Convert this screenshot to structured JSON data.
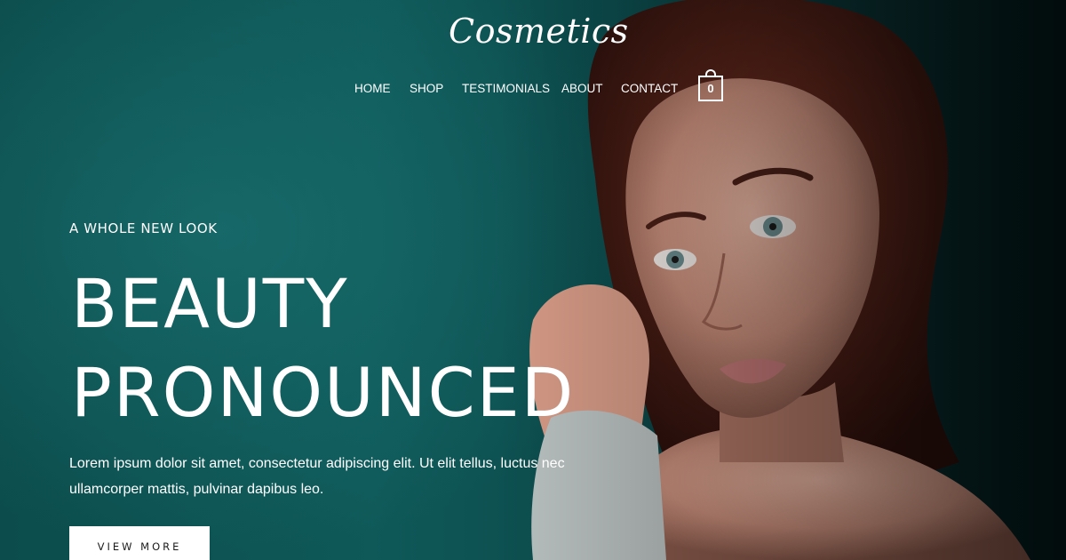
{
  "brand": {
    "logo_text": "Cosmetics"
  },
  "nav": {
    "items": [
      {
        "label": "HOME"
      },
      {
        "label": "SHOP"
      },
      {
        "label": "TESTIMONIALS"
      },
      {
        "label": "ABOUT"
      },
      {
        "label": "CONTACT"
      }
    ],
    "cart": {
      "count": "0",
      "icon": "shopping-bag-icon"
    }
  },
  "hero": {
    "eyebrow": "A WHOLE NEW LOOK",
    "headline_line_1": "BEAUTY",
    "headline_line_2": "PRONOUNCED",
    "body": "Lorem ipsum dolor sit amet, consectetur adipiscing elit. Ut elit tellus, luctus nec ullamcorper mattis, pulvinar dapibus leo.",
    "cta_label": "VIEW MORE"
  },
  "colors": {
    "background_teal": "#0f5959",
    "background_dark": "#041a1b",
    "text": "#ffffff",
    "button_bg": "#ffffff",
    "button_text": "#1b1b1b"
  }
}
